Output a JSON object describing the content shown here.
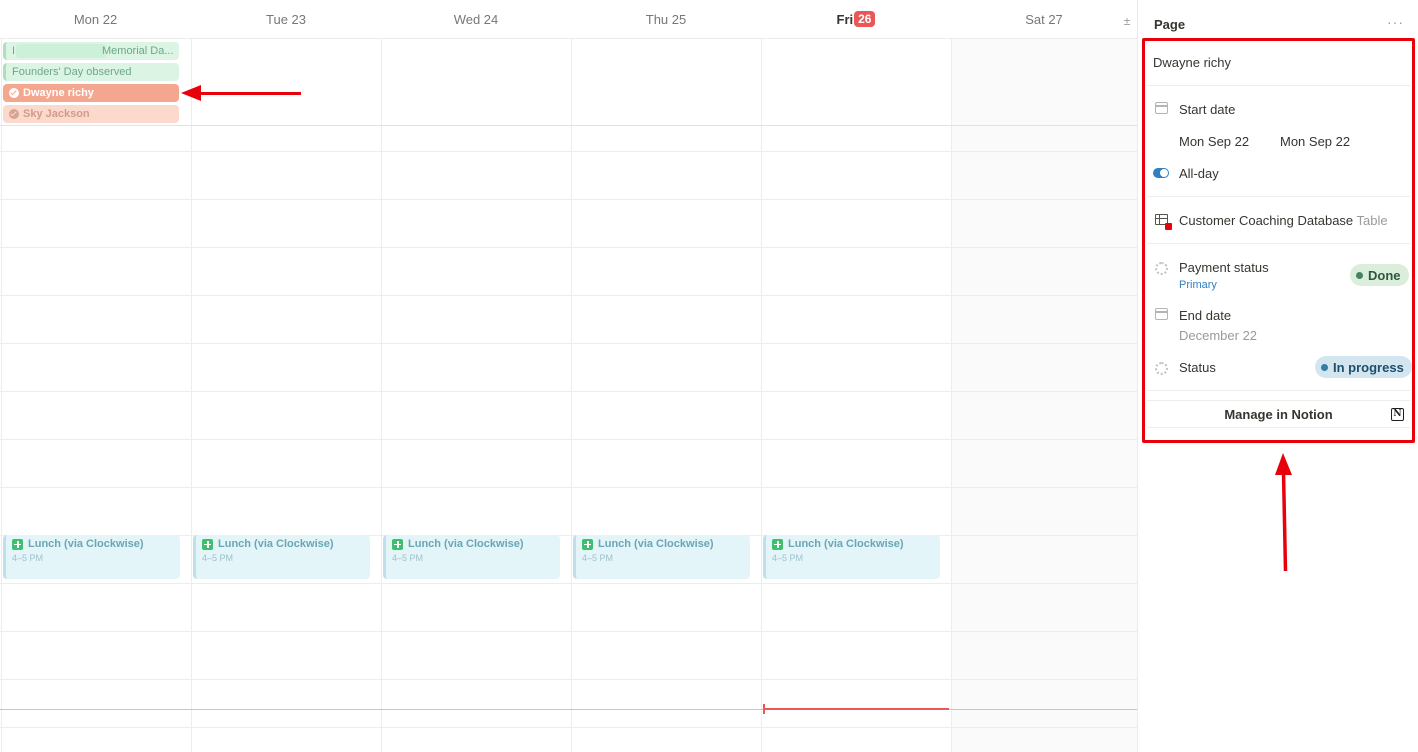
{
  "calendar": {
    "days": [
      {
        "label": "Mon 22"
      },
      {
        "label": "Tue 23"
      },
      {
        "label": "Wed 24"
      },
      {
        "label": "Thu 25"
      },
      {
        "label": "Fri",
        "badge": "26",
        "today": true
      },
      {
        "label": "Sat 27"
      }
    ],
    "expand_icon": "plus-minus-icon",
    "expand_glyph": "±",
    "allday_events": [
      {
        "title": "Memorial Da...",
        "prefix": "I",
        "color": "green"
      },
      {
        "title": "Founders' Day observed",
        "color": "green"
      },
      {
        "title": "Dwayne richy",
        "color": "red",
        "selected": true
      },
      {
        "title": "Sky Jackson",
        "color": "salmon"
      }
    ],
    "lunch_events": [
      {
        "title": "Lunch (via Clockwise)",
        "time": "4–5 PM"
      },
      {
        "title": "Lunch (via Clockwise)",
        "time": "4–5 PM"
      },
      {
        "title": "Lunch (via Clockwise)",
        "time": "4–5 PM"
      },
      {
        "title": "Lunch (via Clockwise)",
        "time": "4–5 PM"
      },
      {
        "title": "Lunch (via Clockwise)",
        "time": "4–5 PM"
      }
    ],
    "colors": {
      "today": "#eb5757",
      "selected_event": "#f4a68f",
      "annotation": "#e8000b"
    }
  },
  "panel": {
    "title": "Page",
    "more_glyph": "···",
    "page_name": "Dwayne richy",
    "start_date_label": "Start date",
    "start_date_from": "Mon Sep 22",
    "start_date_to": "Mon Sep 22",
    "all_day_label": "All-day",
    "database_name": "Customer Coaching Database",
    "database_type": "Table",
    "payment_status_label": "Payment status",
    "payment_status_sub": "Primary",
    "payment_status_value": "Done",
    "end_date_label": "End date",
    "end_date_value": "December 22",
    "status_label": "Status",
    "status_value": "In progress",
    "manage_button": "Manage in Notion",
    "notion_glyph": "N"
  }
}
